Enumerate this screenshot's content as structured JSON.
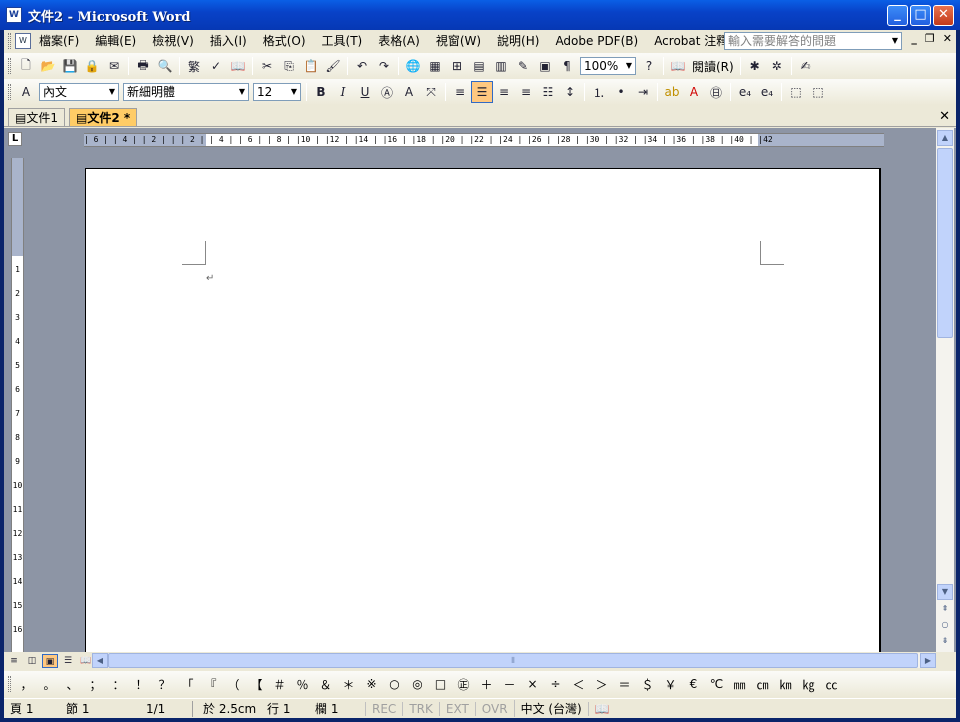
{
  "window": {
    "title": "文件2 - Microsoft Word",
    "icon": "word-doc-icon"
  },
  "menu": {
    "items": [
      "檔案(F)",
      "編輯(E)",
      "檢視(V)",
      "插入(I)",
      "格式(O)",
      "工具(T)",
      "表格(A)",
      "視窗(W)",
      "說明(H)",
      "Adobe PDF(B)",
      "Acrobat 注釋(C)"
    ],
    "help_placeholder": "輸入需要解答的問題"
  },
  "toolbar1": {
    "zoom": "100%",
    "read_label": "閱讀(R)"
  },
  "toolbar2": {
    "style": "內文",
    "font": "新細明體",
    "size": "12",
    "bold": "B",
    "italic": "I",
    "underline": "U"
  },
  "tabs": [
    {
      "label": "文件1"
    },
    {
      "label": "文件2 *"
    }
  ],
  "ruler": {
    "h_marks": "  | 6 | | 4 | | 2 |  |   | 2 | | 4 | | 6 | | 8 | |10 | |12 | |14 | |16 | |18 | |20 | |22 | |24 | |26 | |28 | |30 | |32 | |34 | |36 | |38 | |40 | |42",
    "v_marks": [
      "1",
      "2",
      "3",
      "4",
      "5",
      "6",
      "7",
      "8",
      "9",
      "10",
      "11",
      "12",
      "13",
      "14",
      "15",
      "16"
    ]
  },
  "symbols": [
    "，",
    "。",
    "、",
    "；",
    "：",
    "！",
    "？",
    "「",
    "『",
    "（",
    "【",
    "＃",
    "％",
    "＆",
    "＊",
    "※",
    "○",
    "◎",
    "□",
    "㊣",
    "＋",
    "－",
    "×",
    "÷",
    "＜",
    "＞",
    "＝",
    "＄",
    "￥",
    "€",
    "℃",
    "㎜",
    "㎝",
    "㎞",
    "㎏",
    "㏄"
  ],
  "status": {
    "page": "頁 1",
    "section": "節 1",
    "pages": "1/1",
    "at": "於 2.5cm",
    "line": "行 1",
    "col": "欄 1",
    "rec": "REC",
    "trk": "TRK",
    "ext": "EXT",
    "ovr": "OVR",
    "lang": "中文 (台灣)"
  }
}
